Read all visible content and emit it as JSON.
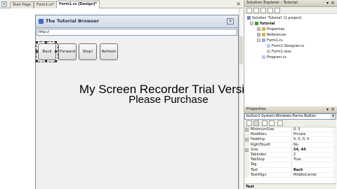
{
  "tabs": [
    {
      "label": "Start Page",
      "active": false
    },
    {
      "label": "Form1.cs*",
      "active": false
    },
    {
      "label": "Form1.cs [Design]*",
      "active": true
    }
  ],
  "form": {
    "title": "The Tutorial Browser",
    "url_value": "http://",
    "buttons": [
      "Back",
      "Forward",
      "Stop!",
      "Refresh"
    ]
  },
  "watermark": {
    "line1": "My Screen Recorder Trial Version",
    "line2": "Please Purchase"
  },
  "solution_explorer": {
    "title": "Solution Explorer - Tutorial",
    "nodes": [
      "Solution 'Tutorial' (1 project)",
      "Tutorial",
      "Properties",
      "References",
      "Form1.cs",
      "Form1.Designer.cs",
      "Form1.resx",
      "Program.cs"
    ]
  },
  "properties": {
    "title": "Properties",
    "object_selector": "button1  System.Windows.Forms.Button",
    "rows": [
      {
        "name": "MinimumSize",
        "value": "0, 0",
        "expander": true,
        "bold": false
      },
      {
        "name": "Modifiers",
        "value": "Private",
        "expander": false,
        "bold": false
      },
      {
        "name": "Padding",
        "value": "0, 0, 0, 0",
        "expander": true,
        "bold": false
      },
      {
        "name": "RightToLeft",
        "value": "No",
        "expander": false,
        "bold": false
      },
      {
        "name": "Size",
        "value": "54, 44",
        "expander": true,
        "bold": true
      },
      {
        "name": "TabIndex",
        "value": "2",
        "expander": false,
        "bold": false
      },
      {
        "name": "TabStop",
        "value": "True",
        "expander": false,
        "bold": false
      },
      {
        "name": "Tag",
        "value": "",
        "expander": false,
        "bold": false
      },
      {
        "name": "Text",
        "value": "Back",
        "expander": false,
        "bold": true
      },
      {
        "name": "TextAlign",
        "value": "MiddleCenter",
        "expander": false,
        "bold": false
      }
    ],
    "description_title": "Text"
  }
}
